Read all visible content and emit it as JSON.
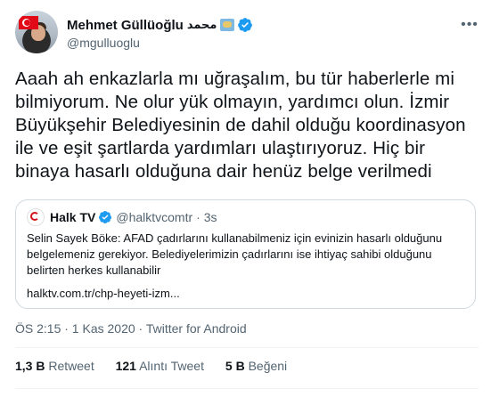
{
  "author": {
    "name": "Mehmet Güllüoğlu",
    "name_extra": "محمد",
    "handle": "@mgulluoglu"
  },
  "tweet_text": "Aaah ah enkazlarla mı uğraşalım, bu tür haberlerle mi bilmiyorum. Ne olur yük olmayın, yardımcı olun. İzmir Büyükşehir Belediyesinin de dahil olduğu koordinasyon ile ve eşit şartlarda yardımları ulaştırıyoruz. Hiç bir binaya hasarlı olduğuna dair henüz belge verilmedi",
  "quoted": {
    "name": "Halk TV",
    "handle": "@halktvcomtr",
    "time": "· 3s",
    "text": "Selin Sayek Böke: AFAD çadırlarını kullanabilmeniz için evinizin hasarlı olduğunu belgelemeniz gerekiyor. Belediyelerimizin çadırlarını ise ihtiyaç sahibi olduğunu belirten herkes kullanabilir",
    "link": "halktv.com.tr/chp-heyeti-izm..."
  },
  "meta": "ÖS 2:15 · 1 Kas 2020 · Twitter for Android",
  "stats": {
    "retweets_count": "1,3 B",
    "retweets_label": "Retweet",
    "quotes_count": "121",
    "quotes_label": "Alıntı Tweet",
    "likes_count": "5 B",
    "likes_label": "Beğeni"
  },
  "colors": {
    "verified": "#1d9bf0",
    "secondary_text": "#536471",
    "border": "#cfd9de"
  },
  "icons": [
    "turkish-flag-icon",
    "map-icon",
    "verified-badge-icon",
    "more-options-icon",
    "halktv-logo-icon"
  ]
}
